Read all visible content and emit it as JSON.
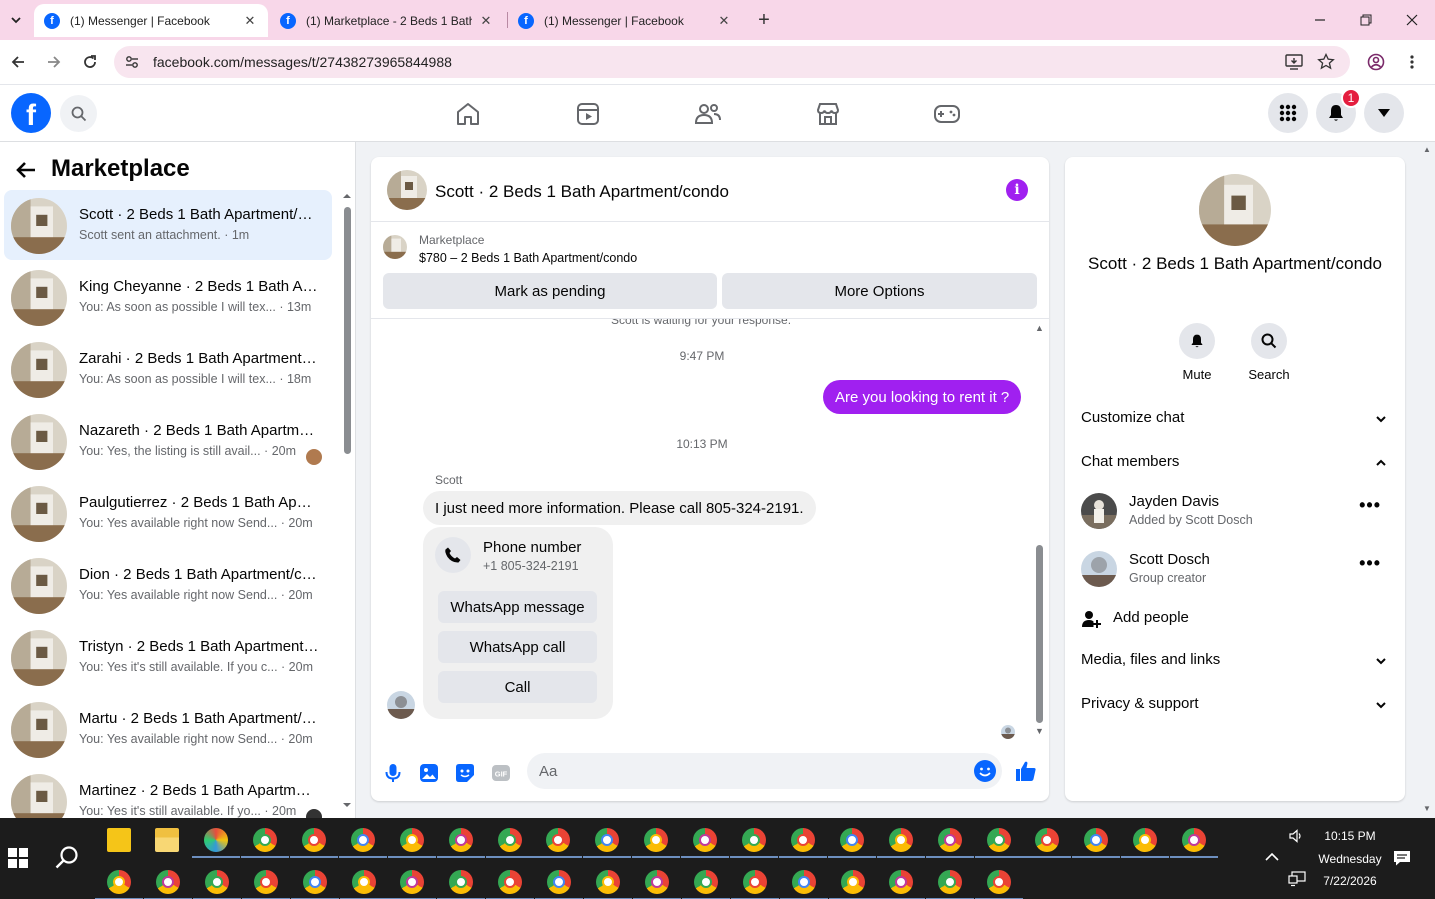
{
  "browser": {
    "tabs": [
      {
        "title": "(1) Messenger | Facebook",
        "active": true
      },
      {
        "title": "(1) Marketplace - 2 Beds 1 Bath",
        "active": false
      },
      {
        "title": "(1) Messenger | Facebook",
        "active": false
      }
    ],
    "url": "facebook.com/messages/t/27438273965844988"
  },
  "fb": {
    "logo_letter": "f",
    "notification_count": "1"
  },
  "left_panel": {
    "title": "Marketplace",
    "conversations": [
      {
        "name": "Scott · 2 Beds 1 Bath Apartment/condo",
        "preview": "Scott sent an attachment. · 1m",
        "active": true
      },
      {
        "name": "King Cheyanne · 2 Beds 1 Bath Apartment/condo",
        "preview": "You: As soon as possible I will tex... · 13m"
      },
      {
        "name": "Zarahi · 2 Beds 1 Bath Apartment/condo",
        "preview": "You: As soon as possible I will tex... · 18m"
      },
      {
        "name": "Nazareth · 2 Beds 1 Bath Apartment/condo",
        "preview": "You: Yes, the listing is still avail... · 20m"
      },
      {
        "name": "Paulgutierrez · 2 Beds 1 Bath Apartment/condo",
        "preview": "You: Yes available right now Send... · 20m"
      },
      {
        "name": "Dion · 2 Beds 1 Bath Apartment/condo",
        "preview": "You: Yes available right now Send... · 20m"
      },
      {
        "name": "Tristyn · 2 Beds 1 Bath Apartment/condo",
        "preview": "You: Yes it's still available. If you c... · 20m"
      },
      {
        "name": "Martu · 2 Beds 1 Bath Apartment/condo",
        "preview": "You: Yes available right now Send... · 20m"
      },
      {
        "name": "Martinez · 2 Beds 1 Bath Apartment/condo",
        "preview": "You: Yes it's still available. If yo... · 20m"
      }
    ]
  },
  "chat": {
    "title": "Scott · 2 Beds 1 Bath Apartment/condo",
    "info_glyph": "i",
    "marketplace_label": "Marketplace",
    "listing": "$780 – 2 Beds 1 Bath Apartment/condo",
    "mark_pending": "Mark as pending",
    "more_options": "More Options",
    "waiting_text": "Scott is waiting for your response.",
    "time1": "9:47 PM",
    "outgoing_msg": "Are you looking to rent it ?",
    "time2": "10:13 PM",
    "sender": "Scott",
    "incoming_msg": "I just need more information. Please call 805-324-2191.",
    "phone_card": {
      "title": "Phone number",
      "number": "+1 805-324-2191",
      "whatsapp_message": "WhatsApp message",
      "whatsapp_call": "WhatsApp call",
      "call": "Call"
    },
    "composer_placeholder": "Aa",
    "gif_label": "GIF"
  },
  "right_panel": {
    "name": "Scott · 2 Beds 1 Bath Apartment/condo",
    "mute": "Mute",
    "search": "Search",
    "customize_chat": "Customize chat",
    "chat_members": "Chat members",
    "members": [
      {
        "name": "Jayden Davis",
        "sub": "Added by Scott Dosch"
      },
      {
        "name": "Scott Dosch",
        "sub": "Group creator"
      }
    ],
    "more_glyph": "•••",
    "add_people": "Add people",
    "media": "Media, files and links",
    "privacy": "Privacy & support"
  },
  "taskbar": {
    "time": "10:15 PM",
    "day": "Wednesday",
    "date": "7/22/2026"
  }
}
